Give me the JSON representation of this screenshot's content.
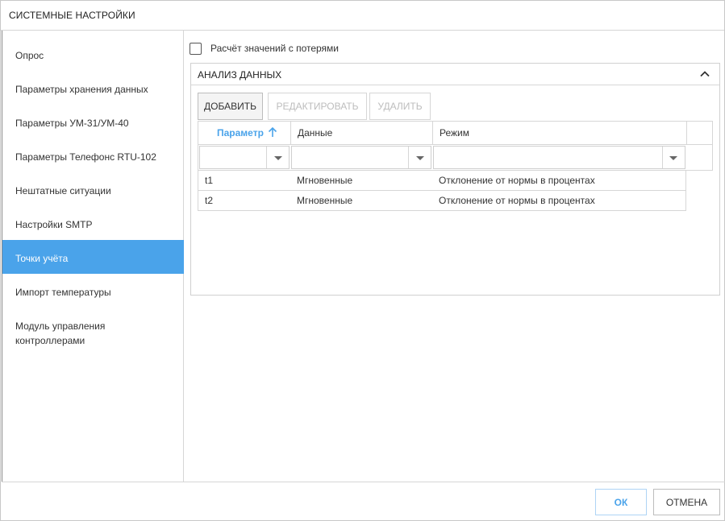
{
  "dialog": {
    "title": "СИСТЕМНЫЕ НАСТРОЙКИ"
  },
  "sidebar": {
    "items": [
      {
        "label": "Опрос",
        "active": false
      },
      {
        "label": "Параметры хранения данных",
        "active": false
      },
      {
        "label": "Параметры УМ-31/УМ-40",
        "active": false
      },
      {
        "label": "Параметры Телефонс RTU-102",
        "active": false
      },
      {
        "label": "Нештатные ситуации",
        "active": false
      },
      {
        "label": "Настройки SMTP",
        "active": false
      },
      {
        "label": "Точки учёта",
        "active": true
      },
      {
        "label": "Импорт температуры",
        "active": false
      },
      {
        "label": "Модуль управления контроллерами",
        "active": false
      }
    ]
  },
  "content": {
    "checkbox": {
      "label": "Расчёт значений с потерями",
      "checked": false
    },
    "panel": {
      "title": "АНАЛИЗ ДАННЫХ",
      "collapse_icon": "chevron-up-icon",
      "toolbar": {
        "add_label": "ДОБАВИТЬ",
        "edit_label": "РЕДАКТИРОВАТЬ",
        "delete_label": "УДАЛИТЬ"
      },
      "grid": {
        "columns": [
          {
            "label": "Параметр",
            "sorted": "asc"
          },
          {
            "label": "Данные"
          },
          {
            "label": "Режим"
          }
        ],
        "sort_icon": "arrow-up-icon",
        "filter_icon": "caret-down-icon",
        "rows": [
          [
            "t1",
            "Мгновенные",
            "Отклонение от нормы в процентах"
          ],
          [
            "t2",
            "Мгновенные",
            "Отклонение от нормы в процентах"
          ]
        ]
      }
    }
  },
  "footer": {
    "ok_label": "ОК",
    "cancel_label": "ОТМЕНА"
  },
  "colors": {
    "accent": "#4aa3ea",
    "border": "#d6d6d6",
    "text": "#333333",
    "disabled_text": "#bdbdbd"
  }
}
